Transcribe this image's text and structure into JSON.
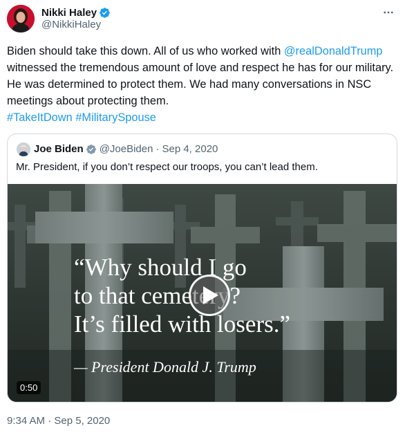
{
  "author": {
    "display_name": "Nikki Haley",
    "handle": "@NikkiHaley",
    "verified_icon": "verified-badge-icon"
  },
  "tweet": {
    "text_1": "Biden should take this down. All of us who worked with ",
    "mention": "@realDonaldTrump",
    "text_2": " witnessed the tremendous amount of love and respect he has for our military. He was determined to protect them. We had many conversations in NSC meetings  about protecting them.",
    "hashtag_1": "#TakeItDown",
    "hashtag_2": "#MilitarySpouse",
    "timestamp": "9:34 AM · Sep 5, 2020",
    "more_icon": "more-options-icon"
  },
  "quoted_tweet": {
    "display_name": "Joe Biden",
    "handle": "@JoeBiden",
    "separator": "·",
    "date": "Sep 4, 2020",
    "text": "Mr. President, if you don’t respect our troops, you can’t lead them.",
    "video": {
      "quote_line_1": "“Why should I go",
      "quote_line_2": "to that cemetery?",
      "quote_line_3": "It’s filled with losers.”",
      "attribution": "— President Donald J. Trump",
      "duration": "0:50",
      "play_icon": "play-icon"
    }
  },
  "colors": {
    "link": "#1d9bf0",
    "secondary_text": "#536471",
    "primary_text": "#0f1419",
    "border": "#cfd9de"
  }
}
